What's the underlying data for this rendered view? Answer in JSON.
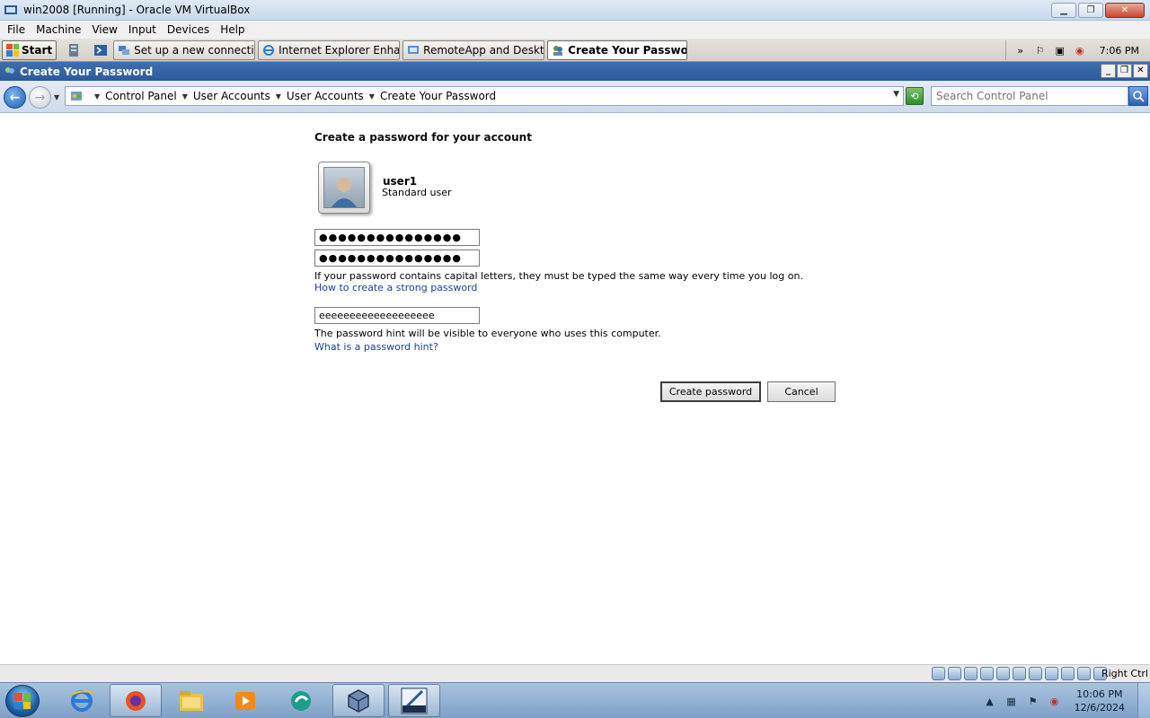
{
  "vbox": {
    "title": "win2008 [Running] - Oracle VM VirtualBox",
    "menu": [
      "File",
      "Machine",
      "View",
      "Input",
      "Devices",
      "Help"
    ],
    "host_key": "Right Ctrl"
  },
  "guest_taskbar": {
    "start_label": "Start",
    "tasks": [
      {
        "label": "Set up a new connection...",
        "active": false
      },
      {
        "label": "Internet Explorer Enhan...",
        "active": false
      },
      {
        "label": "RemoteApp and Desktop...",
        "active": false
      },
      {
        "label": "Create Your Password",
        "active": true
      }
    ],
    "clock": "7:06 PM"
  },
  "window": {
    "title": "Create Your Password"
  },
  "address": {
    "crumbs": [
      "Control Panel",
      "User Accounts",
      "User Accounts",
      "Create Your Password"
    ],
    "search_placeholder": "Search Control Panel"
  },
  "content": {
    "heading": "Create a password for your account",
    "user_name": "user1",
    "user_type": "Standard user",
    "password_value": "●●●●●●●●●●●●●●●",
    "confirm_value": "●●●●●●●●●●●●●●●",
    "caps_note": "If your password contains capital letters, they must be typed the same way every time you log on.",
    "strong_link": "How to create a strong password",
    "hint_value": "eeeeeeeeeeeeeeeeeee",
    "hint_note": "The password hint will be visible to everyone who uses this computer.",
    "hint_link": "What is a password hint?",
    "create_label": "Create password",
    "cancel_label": "Cancel"
  },
  "host_taskbar": {
    "time": "10:06 PM",
    "date": "12/6/2024",
    "pinned_icons": [
      "ie-icon",
      "firefox-icon",
      "explorer-icon",
      "media-player-icon",
      "remote-app-icon",
      "virtualbox-icon",
      "server-2008-icon"
    ]
  },
  "colors": {
    "link": "#1e3e99",
    "title_bar": "#2c5a9a"
  }
}
